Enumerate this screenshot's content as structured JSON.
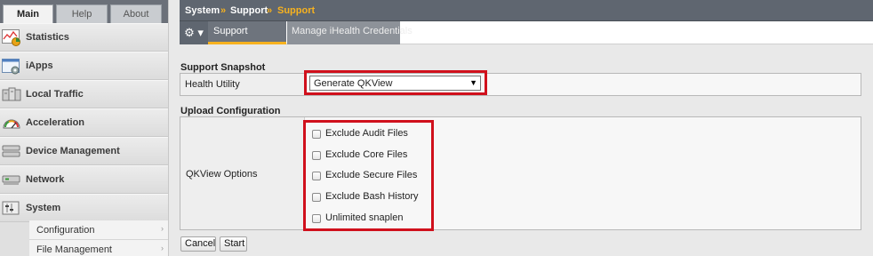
{
  "sidebar": {
    "tabs": [
      {
        "label": "Main",
        "active": true
      },
      {
        "label": "Help",
        "active": false
      },
      {
        "label": "About",
        "active": false
      }
    ],
    "items": [
      {
        "label": "Statistics",
        "icon": "statistics-chart-icon"
      },
      {
        "label": "iApps",
        "icon": "iapps-window-icon"
      },
      {
        "label": "Local Traffic",
        "icon": "local-traffic-servers-icon"
      },
      {
        "label": "Acceleration",
        "icon": "acceleration-gauge-icon"
      },
      {
        "label": "Device Management",
        "icon": "device-management-icon"
      },
      {
        "label": "Network",
        "icon": "network-icon"
      },
      {
        "label": "System",
        "icon": "system-icon"
      }
    ],
    "subitems": [
      {
        "label": "Configuration"
      },
      {
        "label": "File Management"
      }
    ]
  },
  "breadcrumb": {
    "part1": "System",
    "sep1": "»",
    "part2": "Support",
    "sep2": "»",
    "current": "Support"
  },
  "tabs": {
    "gear": "⚙ ▾",
    "support": "Support",
    "ihealth": "Manage iHealth Credentials"
  },
  "snapshot": {
    "section_title": "Support Snapshot",
    "label": "Health Utility",
    "select_value": "Generate QKView"
  },
  "upload": {
    "section_title": "Upload Configuration",
    "label": "QKView Options",
    "options": [
      {
        "label": "Exclude Audit Files",
        "checked": false
      },
      {
        "label": "Exclude Core Files",
        "checked": false
      },
      {
        "label": "Exclude Secure Files",
        "checked": false
      },
      {
        "label": "Exclude Bash History",
        "checked": false
      },
      {
        "label": "Unlimited snaplen",
        "checked": false
      }
    ]
  },
  "buttons": {
    "cancel": "Cancel",
    "start": "Start"
  },
  "colors": {
    "highlight": "#d0101c",
    "breadcrumb_accent": "#f7b21f",
    "header_bg": "#5f6670"
  }
}
